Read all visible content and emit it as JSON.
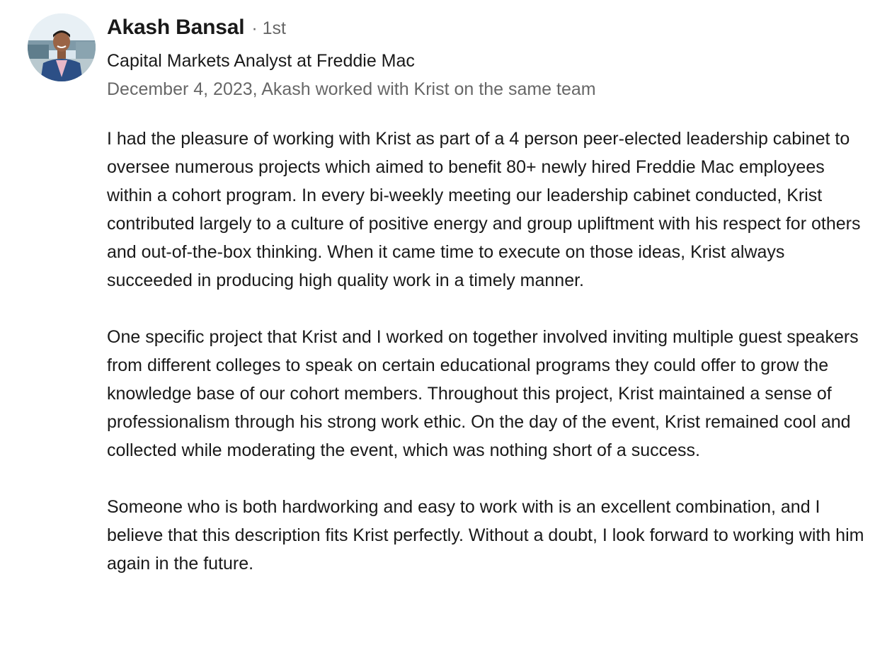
{
  "recommendation": {
    "author_name": "Akash Bansal",
    "degree": "· 1st",
    "headline": "Capital Markets Analyst at Freddie Mac",
    "meta": "December 4, 2023, Akash worked with Krist on the same team",
    "paragraphs": [
      "I had the pleasure of working with Krist as part of a 4 person peer-elected leadership cabinet to oversee numerous projects which aimed to benefit 80+ newly hired Freddie Mac employees within a cohort program. In every bi-weekly meeting our leadership cabinet conducted, Krist contributed largely to a culture of positive energy and group upliftment with his respect for others and out-of-the-box thinking. When it came time to execute on those ideas, Krist always succeeded in producing high quality work in a timely manner.",
      "One specific project that Krist and I worked on together involved inviting multiple guest speakers from different colleges to speak on certain educational programs they could offer to grow the knowledge base of our cohort members. Throughout this project, Krist maintained a sense of professionalism through his strong work ethic. On the day of the event, Krist remained cool and collected while moderating the event, which was nothing short of a success.",
      "Someone who is both hardworking and easy to work with is an excellent combination, and I believe that this description fits Krist perfectly. Without a doubt, I look forward to working with him again in the future."
    ]
  }
}
